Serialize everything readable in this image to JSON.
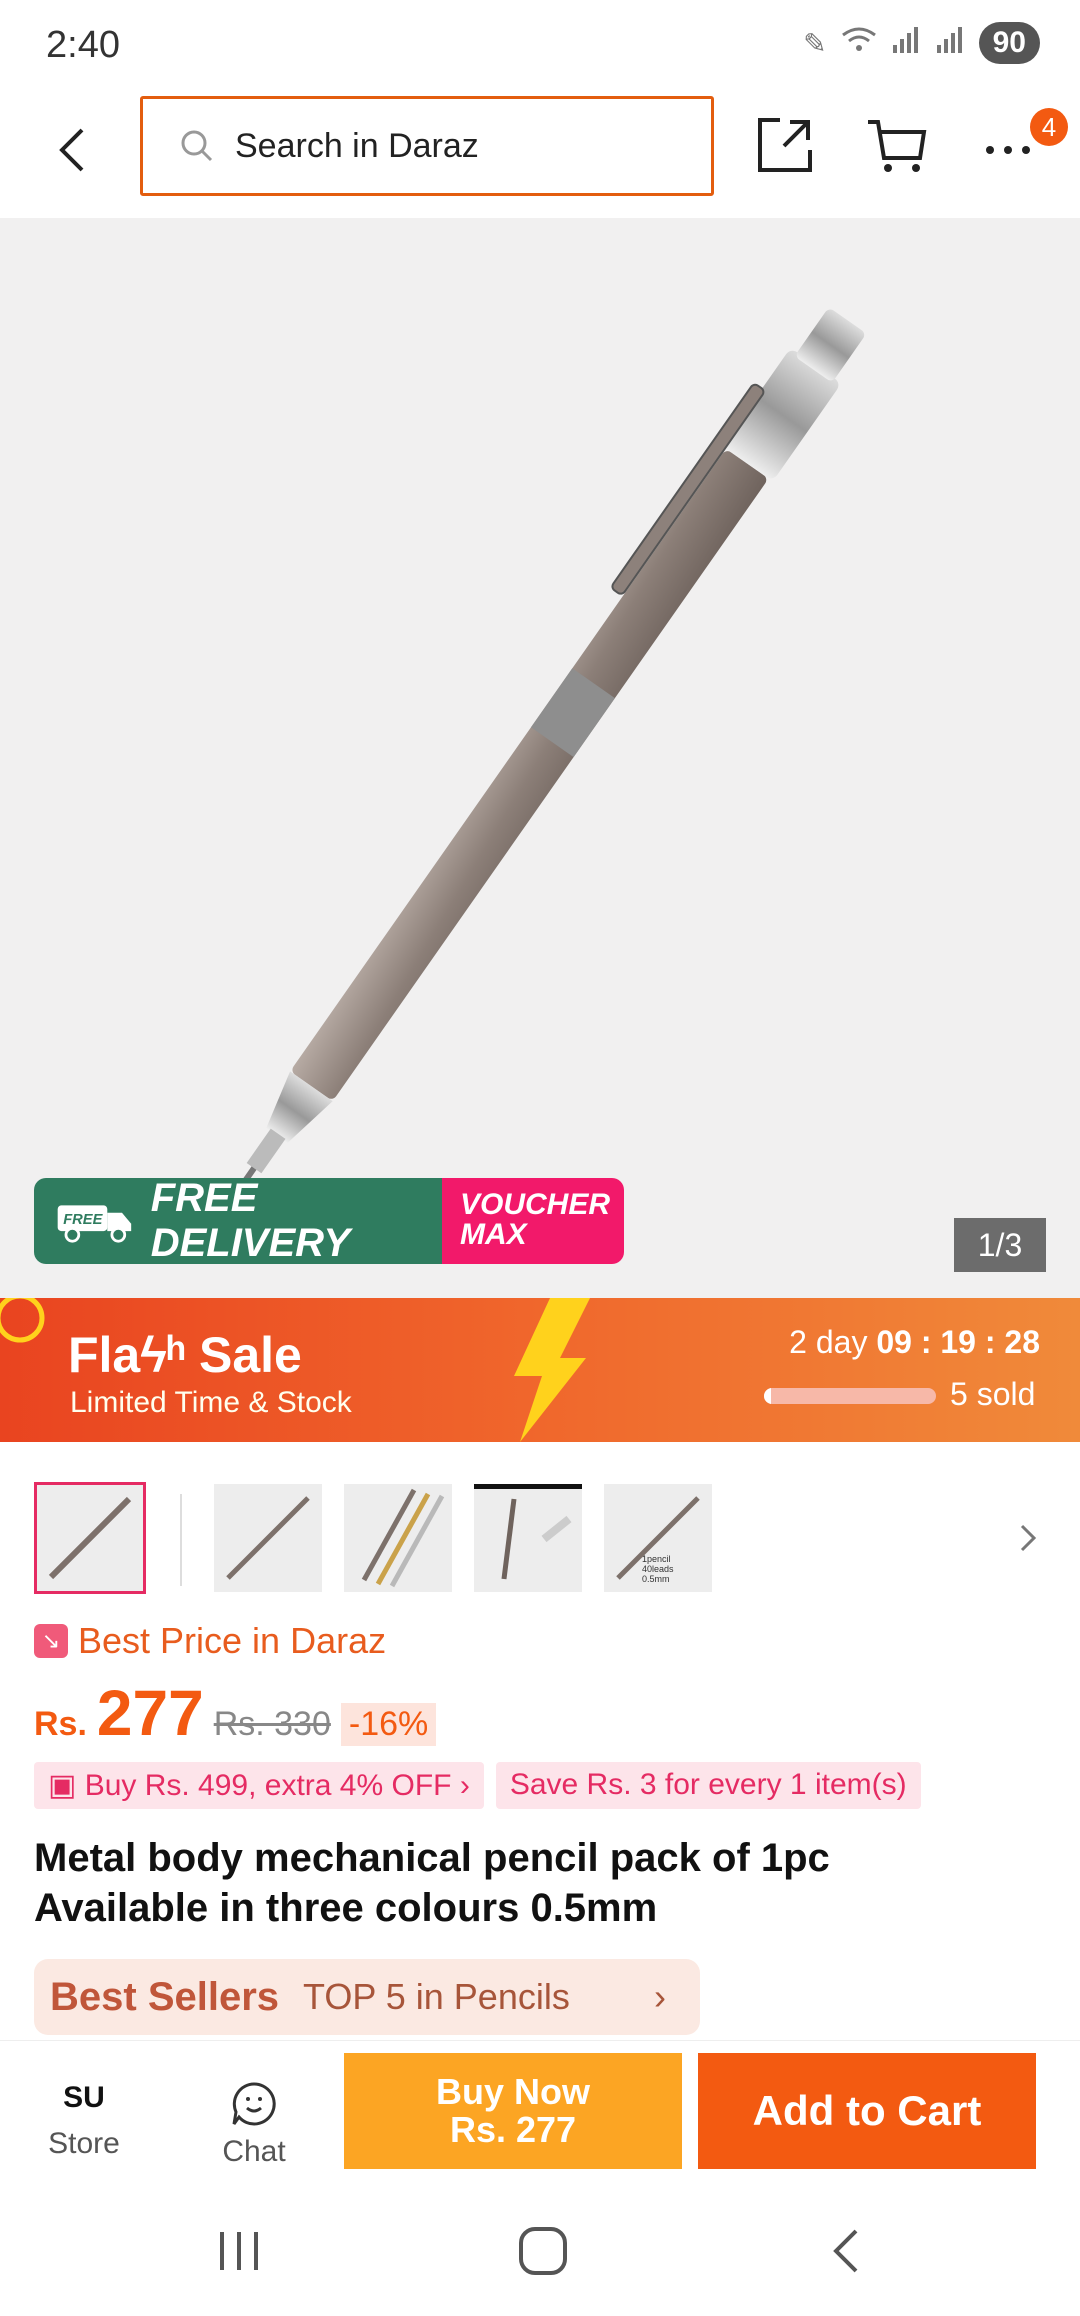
{
  "status": {
    "time": "2:40",
    "battery": "90"
  },
  "search": {
    "placeholder": "Search in Daraz"
  },
  "cart_badge": "4",
  "banner": {
    "free_delivery": "FREE DELIVERY",
    "free_tag": "FREE",
    "voucher_line1": "VOUCHER",
    "voucher_line2": "MAX"
  },
  "gallery": {
    "pager": "1/3"
  },
  "flash_sale": {
    "title": "Flaϟʰ Sale",
    "subtitle": "Limited Time & Stock",
    "countdown_days": "2 day",
    "countdown_h": "09",
    "countdown_m": "19",
    "countdown_s": "28",
    "sold": "5 sold",
    "sold_progress": 0.04
  },
  "thumb_caption": "1pencil 40leads 0.5mm",
  "price": {
    "best_price": "Best Price in Daraz",
    "currency": "Rs.",
    "amount": "277",
    "old_price": "Rs. 330",
    "discount": "-16%"
  },
  "promos": {
    "extra_off": "Buy Rs. 499, extra 4% OFF",
    "save": "Save Rs. 3 for every 1 item(s)"
  },
  "product": {
    "title_line1": "Metal body mechanical pencil pack of 1pc",
    "title_line2": "Available in three colours 0.5mm"
  },
  "best_sellers": {
    "logo": "Best Sellers",
    "text": "TOP 5 in Pencils"
  },
  "bottom": {
    "store_label": "Store",
    "store_logo": "SU",
    "chat_label": "Chat",
    "buy_now_line1": "Buy Now",
    "buy_now_line2": "Rs. 277",
    "add_to_cart": "Add to Cart"
  },
  "colors": {
    "accent": "#f35a11",
    "flash": "#e94420",
    "buy_now": "#fca523",
    "pink": "#e52b63"
  }
}
